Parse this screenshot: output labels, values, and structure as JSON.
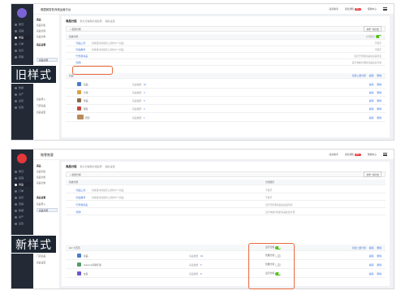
{
  "labels": {
    "old_style": "旧样式",
    "new_style": "新样式"
  },
  "app": {
    "title": "微盟微零售商城运营平台",
    "title_new": "微零售客",
    "header_links": [
      "商家助手",
      "消息通知",
      "帮助中心"
    ],
    "notification_badge": "99+"
  },
  "sidebar_main": [
    "概况",
    "店铺",
    "商品",
    "订单",
    "会员",
    "营销",
    "数据",
    "资产",
    "设置",
    "应用"
  ],
  "sidebar_sub": {
    "section1": "商品",
    "items1": [
      "商品列表",
      "商品分组",
      "商品分类"
    ],
    "section2": "商品设置",
    "items2": [
      "商品分组",
      "商品导入",
      "门店商品",
      "商品设置"
    ]
  },
  "tabs": {
    "current": "商品分组",
    "hint": "默认可编辑分组名称",
    "hint2": "相关设置"
  },
  "toolbar": {
    "add_label": "+ 新建分组",
    "right_btn": "新增一级分组"
  },
  "groups": [
    {
      "name": "系统分组",
      "note": "",
      "right": "分组展示"
    },
    {
      "name": "*商品上架",
      "note": "系统自动将最新上架的10个商品",
      "right": "不展示"
    },
    {
      "name": "*新品推荐",
      "note": "系统自动将最新上架的10个商品",
      "right": "不展示"
    },
    {
      "name": "*已售罄商品",
      "note": "",
      "right": "显示已售罄商品在商品列表"
    },
    {
      "name": "*其他",
      "note": "",
      "right": "显示未被分组的商品在此分组"
    }
  ],
  "list_group": {
    "name": "商品",
    "ops": [
      "新建二级分组",
      "编辑",
      "删除"
    ]
  },
  "items": [
    {
      "name": "商品",
      "count_label": "商品数量",
      "count": "10"
    },
    {
      "name": "分组",
      "count_label": "商品数量",
      "count": "3"
    },
    {
      "name": "饰品",
      "count_label": "商品数量",
      "count": "5"
    },
    {
      "name": "服装",
      "count_label": "商品数量",
      "count": "2"
    },
    {
      "name": "鞋包",
      "count_label": "商品数量",
      "count": "1"
    }
  ],
  "item_ops": [
    "编辑",
    "删除"
  ],
  "new_group": {
    "name": "ahz 大首页",
    "switch_label": "显示分组"
  },
  "new_items": [
    {
      "name": "新品",
      "count_label": "商品数量",
      "count": "10",
      "switch_label": "隐藏分组",
      "on": false
    },
    {
      "name": "welcome到我们家",
      "count_label": "商品数量",
      "count": "5",
      "switch_label": "隐藏分组",
      "on": false
    },
    {
      "name": "女装",
      "count_label": "商品数量",
      "count": "8",
      "switch_label": "显示分组",
      "on": true
    }
  ],
  "colors": {
    "accent": "#3b73d8",
    "highlight": "#e86a3a",
    "sidebar": "#232a36",
    "switch_on": "#52c41a"
  }
}
